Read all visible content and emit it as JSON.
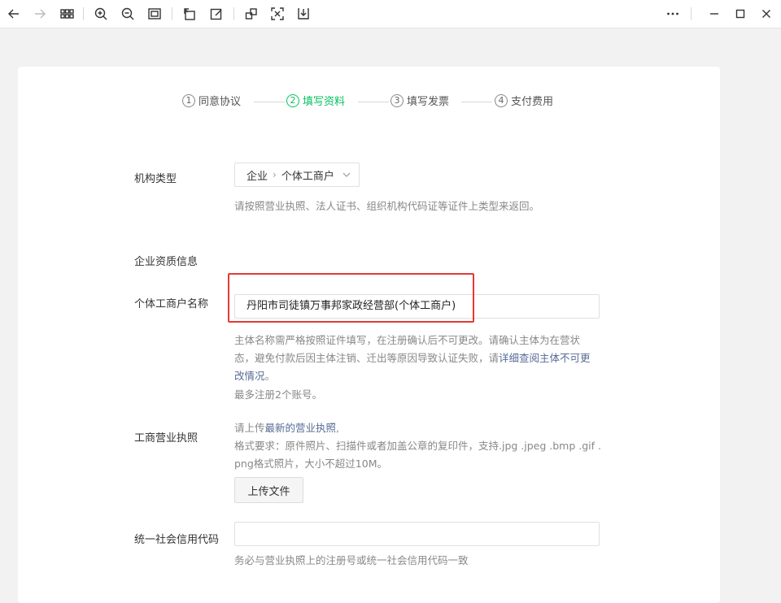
{
  "toolbar": {
    "icons": [
      "arrow-left-icon",
      "arrow-right-icon",
      "grid-icon",
      "zoom-in-icon",
      "zoom-out-icon",
      "fit-screen-icon",
      "rotate-icon",
      "edit-icon",
      "copy-icon",
      "scan-icon",
      "download-icon",
      "more-icon",
      "minimize-icon",
      "maximize-icon",
      "close-icon"
    ]
  },
  "steps": [
    {
      "num": "1",
      "label": "同意协议"
    },
    {
      "num": "2",
      "label": "填写资料"
    },
    {
      "num": "3",
      "label": "填写发票"
    },
    {
      "num": "4",
      "label": "支付费用"
    }
  ],
  "form": {
    "org_type": {
      "label": "机构类型",
      "value_1": "企业",
      "value_2": "个体工商户",
      "help": "请按照营业执照、法人证书、组织机构代码证等证件上类型来返回。"
    },
    "section_title": "企业资质信息",
    "business_name": {
      "label": "个体工商户名称",
      "value": "丹阳市司徒镇万事邦家政经营部(个体工商户)",
      "help_line1": "主体名称需严格按照证件填写，在注册确认后不可更改。请确认主体为在营状",
      "help_line2_a": "态，避免付款后因主体注销、迁出等原因导致认证失败，请",
      "help_line2_link": "详细查阅主体不可更",
      "help_line3_link": "改情况",
      "help_line3_end": "。",
      "help_limit": "最多注册2个账号。"
    },
    "license": {
      "label": "工商营业执照",
      "help_prefix": "请上传",
      "help_link": "最新的营业执照",
      "help_suffix": ",",
      "format_line1": "格式要求：原件照片、扫描件或者加盖公章的复印件，支持.jpg .jpeg .bmp .gif .",
      "format_line2": "png格式照片，大小不超过10M。",
      "upload_button": "上传文件"
    },
    "credit_code": {
      "label": "统一社会信用代码",
      "value": "",
      "help": "务必与营业执照上的注册号或统一社会信用代码一致"
    }
  },
  "colors": {
    "accent": "#07c160",
    "link": "#576b95",
    "highlight": "#e53935"
  }
}
